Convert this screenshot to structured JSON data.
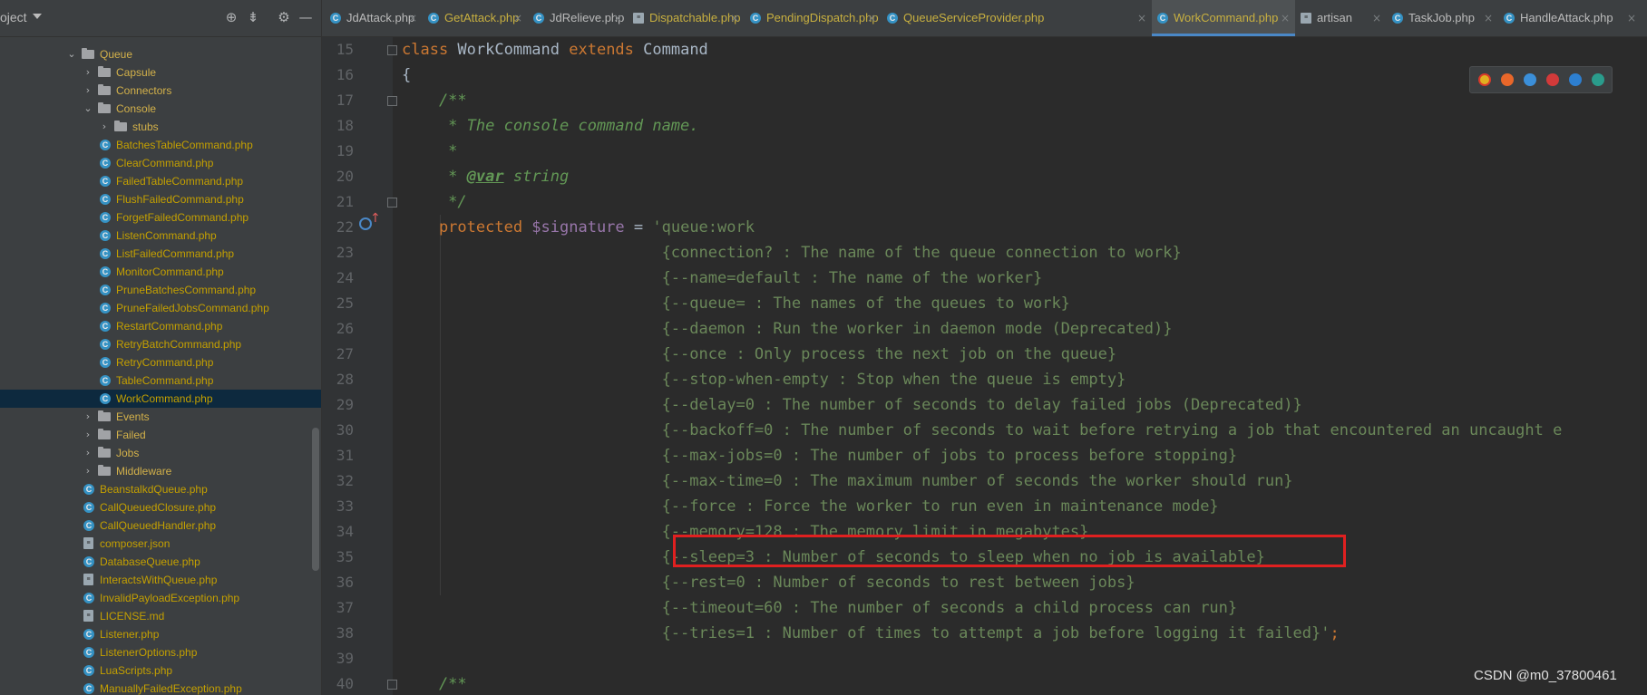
{
  "project": {
    "title": "oject",
    "tree": [
      {
        "label": "Queue",
        "type": "folder",
        "expanded": true
      },
      {
        "label": "Capsule",
        "type": "folder",
        "expanded": false
      },
      {
        "label": "Connectors",
        "type": "folder",
        "expanded": false
      },
      {
        "label": "Console",
        "type": "folder",
        "expanded": true
      },
      {
        "label": "stubs",
        "type": "folder",
        "expanded": false
      },
      {
        "label": "BatchesTableCommand.php",
        "type": "class"
      },
      {
        "label": "ClearCommand.php",
        "type": "class"
      },
      {
        "label": "FailedTableCommand.php",
        "type": "class"
      },
      {
        "label": "FlushFailedCommand.php",
        "type": "class"
      },
      {
        "label": "ForgetFailedCommand.php",
        "type": "class"
      },
      {
        "label": "ListenCommand.php",
        "type": "class"
      },
      {
        "label": "ListFailedCommand.php",
        "type": "class"
      },
      {
        "label": "MonitorCommand.php",
        "type": "class"
      },
      {
        "label": "PruneBatchesCommand.php",
        "type": "class"
      },
      {
        "label": "PruneFailedJobsCommand.php",
        "type": "class"
      },
      {
        "label": "RestartCommand.php",
        "type": "class"
      },
      {
        "label": "RetryBatchCommand.php",
        "type": "class"
      },
      {
        "label": "RetryCommand.php",
        "type": "class"
      },
      {
        "label": "TableCommand.php",
        "type": "class"
      },
      {
        "label": "WorkCommand.php",
        "type": "class",
        "selected": true
      },
      {
        "label": "Events",
        "type": "folder",
        "expanded": false
      },
      {
        "label": "Failed",
        "type": "folder",
        "expanded": false
      },
      {
        "label": "Jobs",
        "type": "folder",
        "expanded": false
      },
      {
        "label": "Middleware",
        "type": "folder",
        "expanded": false
      },
      {
        "label": "BeanstalkdQueue.php",
        "type": "class"
      },
      {
        "label": "CallQueuedClosure.php",
        "type": "class"
      },
      {
        "label": "CallQueuedHandler.php",
        "type": "class"
      },
      {
        "label": "composer.json",
        "type": "file"
      },
      {
        "label": "DatabaseQueue.php",
        "type": "class"
      },
      {
        "label": "InteractsWithQueue.php",
        "type": "file"
      },
      {
        "label": "InvalidPayloadException.php",
        "type": "class"
      },
      {
        "label": "LICENSE.md",
        "type": "file"
      },
      {
        "label": "Listener.php",
        "type": "class"
      },
      {
        "label": "ListenerOptions.php",
        "type": "class"
      },
      {
        "label": "LuaScripts.php",
        "type": "class"
      },
      {
        "label": "ManuallyFailedException.php",
        "type": "class"
      }
    ]
  },
  "tabs": [
    {
      "label": "JdAttack.php",
      "icon": "class"
    },
    {
      "label": "GetAttack.php",
      "icon": "class"
    },
    {
      "label": "JdRelieve.php",
      "icon": "class"
    },
    {
      "label": "Dispatchable.php",
      "icon": "file"
    },
    {
      "label": "PendingDispatch.php",
      "icon": "class"
    },
    {
      "label": "QueueServiceProvider.php",
      "icon": "class"
    },
    {
      "label": "WorkCommand.php",
      "icon": "class",
      "active": true
    },
    {
      "label": "artisan",
      "icon": "file"
    },
    {
      "label": "TaskJob.php",
      "icon": "class"
    },
    {
      "label": "HandleAttack.php",
      "icon": "class"
    }
  ],
  "editor": {
    "lines": [
      {
        "n": "15",
        "parts": [
          [
            "kw",
            "class "
          ],
          [
            "",
            "WorkCommand "
          ],
          [
            "kw",
            "extends "
          ],
          [
            "",
            "Command"
          ]
        ]
      },
      {
        "n": "16",
        "parts": [
          [
            "",
            "{"
          ]
        ]
      },
      {
        "n": "17",
        "parts": [
          [
            "doc",
            "    /**"
          ]
        ]
      },
      {
        "n": "18",
        "parts": [
          [
            "doc",
            "     * The console command name."
          ]
        ]
      },
      {
        "n": "19",
        "parts": [
          [
            "doc",
            "     *"
          ]
        ]
      },
      {
        "n": "20",
        "parts": [
          [
            "doc",
            "     * "
          ],
          [
            "doctag",
            "@var"
          ],
          [
            "doc",
            " string"
          ]
        ]
      },
      {
        "n": "21",
        "parts": [
          [
            "doc",
            "     */"
          ]
        ]
      },
      {
        "n": "22",
        "parts": [
          [
            "kw",
            "    protected "
          ],
          [
            "var",
            "$signature"
          ],
          [
            "",
            " = "
          ],
          [
            "str",
            "'queue:work"
          ]
        ]
      },
      {
        "n": "23",
        "parts": [
          [
            "str",
            "                            {connection? : The name of the queue connection to work}"
          ]
        ]
      },
      {
        "n": "24",
        "parts": [
          [
            "str",
            "                            {--name=default : The name of the worker}"
          ]
        ]
      },
      {
        "n": "25",
        "parts": [
          [
            "str",
            "                            {--queue= : The names of the queues to work}"
          ]
        ]
      },
      {
        "n": "26",
        "parts": [
          [
            "str",
            "                            {--daemon : Run the worker in daemon mode (Deprecated)}"
          ]
        ]
      },
      {
        "n": "27",
        "parts": [
          [
            "str",
            "                            {--once : Only process the next job on the queue}"
          ]
        ]
      },
      {
        "n": "28",
        "parts": [
          [
            "str",
            "                            {--stop-when-empty : Stop when the queue is empty}"
          ]
        ]
      },
      {
        "n": "29",
        "parts": [
          [
            "str",
            "                            {--delay=0 : The number of seconds to delay failed jobs (Deprecated)}"
          ]
        ]
      },
      {
        "n": "30",
        "parts": [
          [
            "str",
            "                            {--backoff=0 : The number of seconds to wait before retrying a job that encountered an uncaught e"
          ]
        ]
      },
      {
        "n": "31",
        "parts": [
          [
            "str",
            "                            {--max-jobs=0 : The number of jobs to process before stopping}"
          ]
        ]
      },
      {
        "n": "32",
        "parts": [
          [
            "str",
            "                            {--max-time=0 : The maximum number of seconds the worker should run}"
          ]
        ]
      },
      {
        "n": "33",
        "parts": [
          [
            "str",
            "                            {--force : Force the worker to run even in maintenance mode}"
          ]
        ]
      },
      {
        "n": "34",
        "parts": [
          [
            "str",
            "                            {--memory=128 : The memory limit in megabytes}"
          ]
        ]
      },
      {
        "n": "35",
        "parts": [
          [
            "str",
            "                            {--sleep=3 : Number of seconds to sleep when no job is available}"
          ]
        ]
      },
      {
        "n": "36",
        "parts": [
          [
            "str",
            "                            {--rest=0 : Number of seconds to rest between jobs}"
          ]
        ]
      },
      {
        "n": "37",
        "parts": [
          [
            "str",
            "                            {--timeout=60 : The number of seconds a child process can run}"
          ]
        ]
      },
      {
        "n": "38",
        "parts": [
          [
            "str",
            "                            {--tries=1 : Number of times to attempt a job before logging it failed}'"
          ],
          [
            "kw",
            ";"
          ]
        ]
      },
      {
        "n": "39",
        "parts": [
          [
            "",
            ""
          ]
        ]
      },
      {
        "n": "40",
        "parts": [
          [
            "doc",
            "    /**"
          ]
        ]
      }
    ]
  },
  "watermark": "CSDN @m0_37800461",
  "colors": {
    "keyword": "#cc7832",
    "doc": "#629755",
    "string": "#6a8759",
    "variable": "#9876aa",
    "highlight": "#e02020",
    "accent": "#4a88c7"
  }
}
